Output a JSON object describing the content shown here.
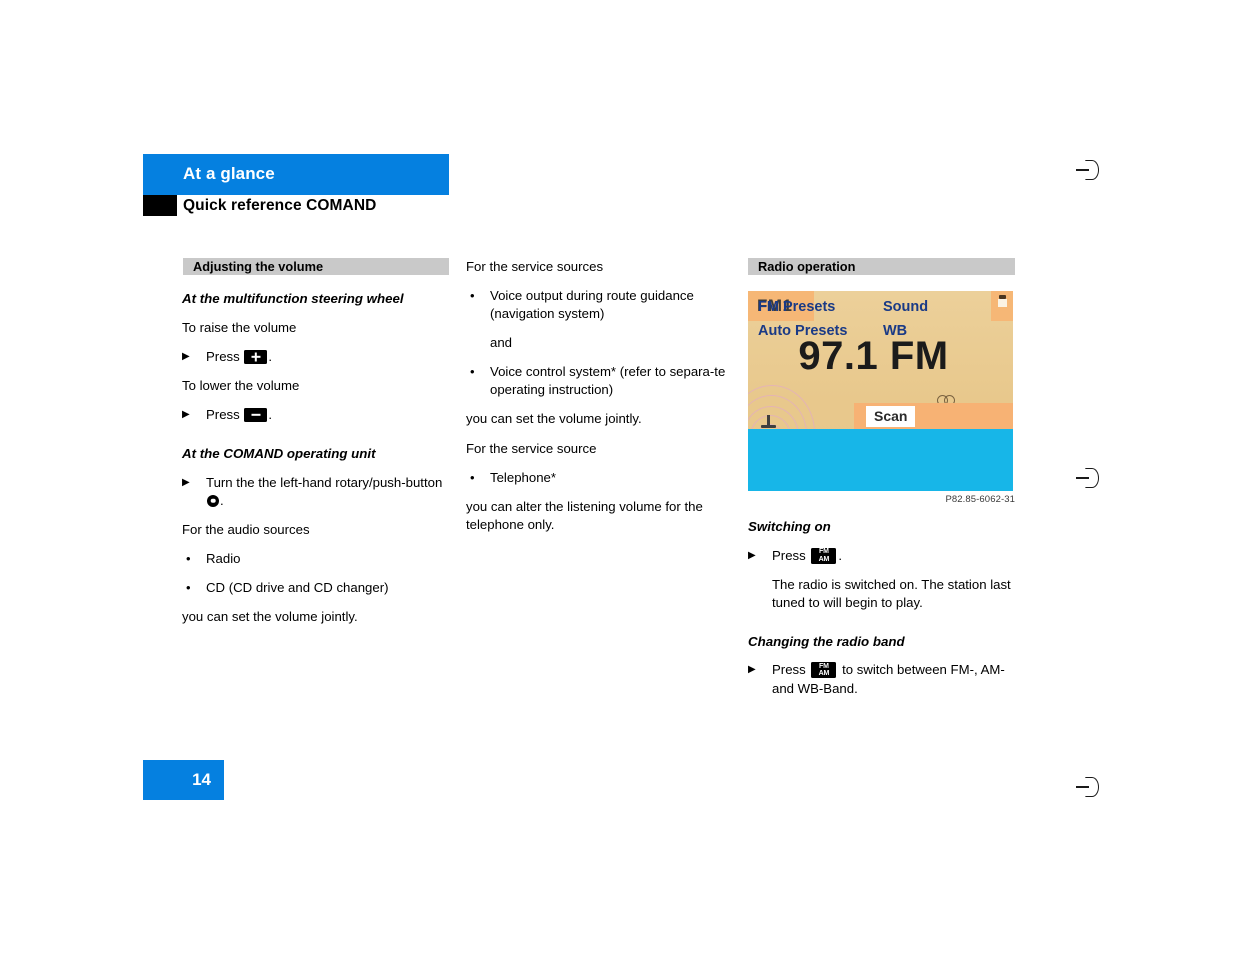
{
  "header": {
    "chapter_title": "At a glance",
    "subtitle": "Quick reference COMAND",
    "blue_color": "#0580e0",
    "black_marker_color": "#000000"
  },
  "left_column": {
    "section_title": "Adjusting the volume",
    "subheading_1": "At the multifunction steering wheel",
    "line_raise": "To raise the volume",
    "press_raise_prefix": "Press",
    "press_raise_suffix": ".",
    "press_raise_icon": "volume-up-key-icon",
    "line_lower": "To lower the volume",
    "press_lower_prefix": "Press",
    "press_lower_suffix": ".",
    "press_lower_icon": "volume-down-key-icon",
    "subheading_2": "At the COMAND operating unit",
    "turn_instruction_prefix": "Turn the the left-hand rotary/push-button",
    "turn_instruction_suffix": ".",
    "turn_instruction_icon": "rotary-push-button-icon",
    "audio_sources_intro": "For the audio sources",
    "audio_sources": [
      "Radio",
      "CD (CD drive and CD changer)"
    ],
    "audio_sources_outro": "you can set the volume jointly."
  },
  "mid_column": {
    "service_sources_intro": "For the service sources",
    "service_sources": [
      "Voice output during route guidance (navigation system)",
      "Voice control system* (refer to separa-te operating instruction)"
    ],
    "service_sources_connector": "and",
    "service_sources_outro": "you can set the volume jointly.",
    "service_source_intro": "For the service source",
    "service_source_item": "Telephone*",
    "service_source_outro": "you can alter the listening volume for the telephone only."
  },
  "right_column": {
    "section_title": "Radio operation",
    "radio_display": {
      "band_tab": "FM1",
      "frequency": "97.1 FM",
      "stereo_indicator_icon": "stereo-circles-icon",
      "tower_icon": "radio-tower-icon",
      "corner_icon": "traffic-info-icon",
      "scan_button": "Scan",
      "menu_items": [
        "FM Presets",
        "Auto Presets",
        "Sound",
        "WB"
      ],
      "colors": {
        "screen_background": "#e8c88c",
        "tab_orange": "#f6b776",
        "menu_blue": "#17b6e8",
        "menu_text": "#1a3a86"
      }
    },
    "figure_caption": "P82.85-6062-31",
    "subheading_switching_on": "Switching on",
    "switching_on_press_prefix": "Press",
    "switching_on_press_suffix": ".",
    "switching_on_icon": "fm-am-key-icon",
    "switching_on_result": "The radio is switched on. The station last tuned to will begin to play.",
    "subheading_changing_band": "Changing the radio band",
    "changing_band_press_prefix": "Press",
    "changing_band_press_middle": "to switch between FM-, AM- and WB-Band.",
    "changing_band_icon": "fm-am-key-icon"
  },
  "footer": {
    "page_number": "14"
  },
  "icons": {
    "fm_am_top": "FM",
    "fm_am_bottom": "AM",
    "arrow_marker": "▶",
    "bullet_marker": "•"
  }
}
